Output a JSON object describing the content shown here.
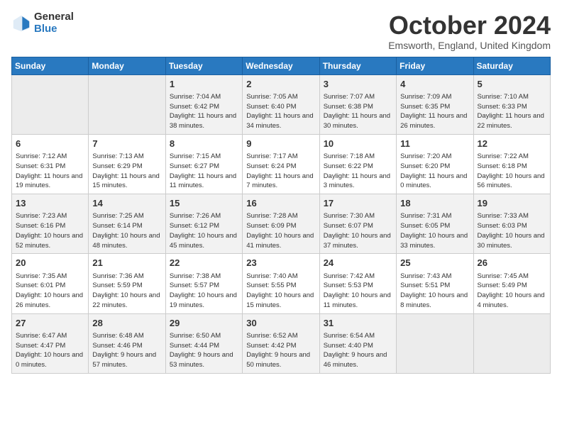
{
  "header": {
    "logo_general": "General",
    "logo_blue": "Blue",
    "month_title": "October 2024",
    "subtitle": "Emsworth, England, United Kingdom"
  },
  "days_of_week": [
    "Sunday",
    "Monday",
    "Tuesday",
    "Wednesday",
    "Thursday",
    "Friday",
    "Saturday"
  ],
  "weeks": [
    [
      {
        "day": "",
        "info": ""
      },
      {
        "day": "",
        "info": ""
      },
      {
        "day": "1",
        "info": "Sunrise: 7:04 AM\nSunset: 6:42 PM\nDaylight: 11 hours and 38 minutes."
      },
      {
        "day": "2",
        "info": "Sunrise: 7:05 AM\nSunset: 6:40 PM\nDaylight: 11 hours and 34 minutes."
      },
      {
        "day": "3",
        "info": "Sunrise: 7:07 AM\nSunset: 6:38 PM\nDaylight: 11 hours and 30 minutes."
      },
      {
        "day": "4",
        "info": "Sunrise: 7:09 AM\nSunset: 6:35 PM\nDaylight: 11 hours and 26 minutes."
      },
      {
        "day": "5",
        "info": "Sunrise: 7:10 AM\nSunset: 6:33 PM\nDaylight: 11 hours and 22 minutes."
      }
    ],
    [
      {
        "day": "6",
        "info": "Sunrise: 7:12 AM\nSunset: 6:31 PM\nDaylight: 11 hours and 19 minutes."
      },
      {
        "day": "7",
        "info": "Sunrise: 7:13 AM\nSunset: 6:29 PM\nDaylight: 11 hours and 15 minutes."
      },
      {
        "day": "8",
        "info": "Sunrise: 7:15 AM\nSunset: 6:27 PM\nDaylight: 11 hours and 11 minutes."
      },
      {
        "day": "9",
        "info": "Sunrise: 7:17 AM\nSunset: 6:24 PM\nDaylight: 11 hours and 7 minutes."
      },
      {
        "day": "10",
        "info": "Sunrise: 7:18 AM\nSunset: 6:22 PM\nDaylight: 11 hours and 3 minutes."
      },
      {
        "day": "11",
        "info": "Sunrise: 7:20 AM\nSunset: 6:20 PM\nDaylight: 11 hours and 0 minutes."
      },
      {
        "day": "12",
        "info": "Sunrise: 7:22 AM\nSunset: 6:18 PM\nDaylight: 10 hours and 56 minutes."
      }
    ],
    [
      {
        "day": "13",
        "info": "Sunrise: 7:23 AM\nSunset: 6:16 PM\nDaylight: 10 hours and 52 minutes."
      },
      {
        "day": "14",
        "info": "Sunrise: 7:25 AM\nSunset: 6:14 PM\nDaylight: 10 hours and 48 minutes."
      },
      {
        "day": "15",
        "info": "Sunrise: 7:26 AM\nSunset: 6:12 PM\nDaylight: 10 hours and 45 minutes."
      },
      {
        "day": "16",
        "info": "Sunrise: 7:28 AM\nSunset: 6:09 PM\nDaylight: 10 hours and 41 minutes."
      },
      {
        "day": "17",
        "info": "Sunrise: 7:30 AM\nSunset: 6:07 PM\nDaylight: 10 hours and 37 minutes."
      },
      {
        "day": "18",
        "info": "Sunrise: 7:31 AM\nSunset: 6:05 PM\nDaylight: 10 hours and 33 minutes."
      },
      {
        "day": "19",
        "info": "Sunrise: 7:33 AM\nSunset: 6:03 PM\nDaylight: 10 hours and 30 minutes."
      }
    ],
    [
      {
        "day": "20",
        "info": "Sunrise: 7:35 AM\nSunset: 6:01 PM\nDaylight: 10 hours and 26 minutes."
      },
      {
        "day": "21",
        "info": "Sunrise: 7:36 AM\nSunset: 5:59 PM\nDaylight: 10 hours and 22 minutes."
      },
      {
        "day": "22",
        "info": "Sunrise: 7:38 AM\nSunset: 5:57 PM\nDaylight: 10 hours and 19 minutes."
      },
      {
        "day": "23",
        "info": "Sunrise: 7:40 AM\nSunset: 5:55 PM\nDaylight: 10 hours and 15 minutes."
      },
      {
        "day": "24",
        "info": "Sunrise: 7:42 AM\nSunset: 5:53 PM\nDaylight: 10 hours and 11 minutes."
      },
      {
        "day": "25",
        "info": "Sunrise: 7:43 AM\nSunset: 5:51 PM\nDaylight: 10 hours and 8 minutes."
      },
      {
        "day": "26",
        "info": "Sunrise: 7:45 AM\nSunset: 5:49 PM\nDaylight: 10 hours and 4 minutes."
      }
    ],
    [
      {
        "day": "27",
        "info": "Sunrise: 6:47 AM\nSunset: 4:47 PM\nDaylight: 10 hours and 0 minutes."
      },
      {
        "day": "28",
        "info": "Sunrise: 6:48 AM\nSunset: 4:46 PM\nDaylight: 9 hours and 57 minutes."
      },
      {
        "day": "29",
        "info": "Sunrise: 6:50 AM\nSunset: 4:44 PM\nDaylight: 9 hours and 53 minutes."
      },
      {
        "day": "30",
        "info": "Sunrise: 6:52 AM\nSunset: 4:42 PM\nDaylight: 9 hours and 50 minutes."
      },
      {
        "day": "31",
        "info": "Sunrise: 6:54 AM\nSunset: 4:40 PM\nDaylight: 9 hours and 46 minutes."
      },
      {
        "day": "",
        "info": ""
      },
      {
        "day": "",
        "info": ""
      }
    ]
  ]
}
